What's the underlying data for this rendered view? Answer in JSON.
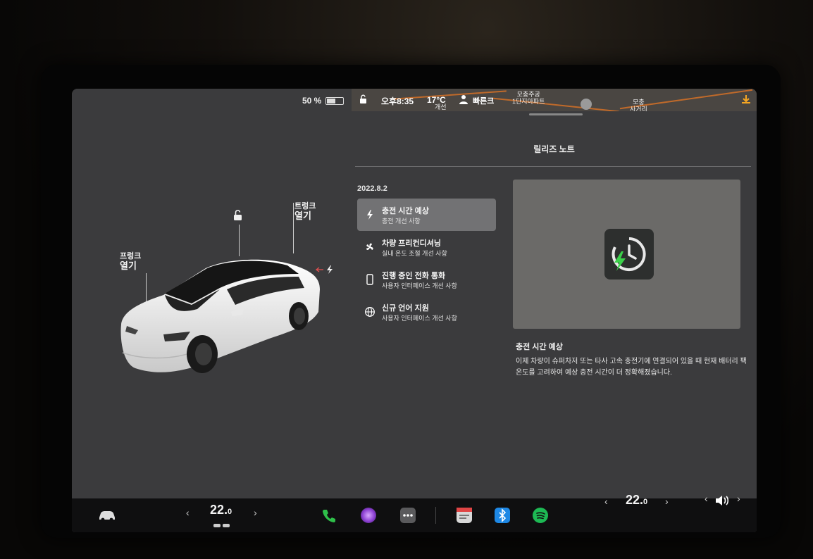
{
  "status": {
    "battery": "50 %",
    "battery_level": 0.5,
    "time": "오후8:35",
    "temperature": "17°C",
    "weather_note": "개선",
    "user": "빠른크",
    "map_label_1_line1": "모충주공",
    "map_label_1_line2": "1단지아파트",
    "map_label_2_line1": "모충",
    "map_label_2_line2": "사거리"
  },
  "car": {
    "frunk_line1": "프렁크",
    "frunk_line2": "열기",
    "trunk_line1": "트렁크",
    "trunk_line2": "열기"
  },
  "release_notes": {
    "title": "릴리즈 노트",
    "version": "2022.8.2",
    "items": [
      {
        "title": "충전 시간 예상",
        "subtitle": "충전 개선 사항",
        "icon": "bolt-icon"
      },
      {
        "title": "차량 프리컨디셔닝",
        "subtitle": "실내 온도 조절 개선 사항",
        "icon": "fan-icon"
      },
      {
        "title": "진행 중인 전화 통화",
        "subtitle": "사용자 인터페이스 개선 사항",
        "icon": "phone-icon"
      },
      {
        "title": "신규 언어 지원",
        "subtitle": "사용자 인터페이스 개선 사항",
        "icon": "globe-icon"
      }
    ],
    "detail_title": "충전 시간 예상",
    "detail_body": "이제 차량이 슈퍼차저 또는 타사 고속 충전기에 연결되어 있을 때 현재 배터리 팩 온도를 고려하여 예상 충전 시간이 더 정확해졌습니다."
  },
  "dock": {
    "driver_temp": "22.",
    "driver_temp_decimal": "0",
    "passenger_temp": "22.",
    "passenger_temp_decimal": "0",
    "colors": {
      "phone": "#2fbf4a",
      "bluetooth": "#1e88e5",
      "spotify": "#1db954"
    }
  }
}
